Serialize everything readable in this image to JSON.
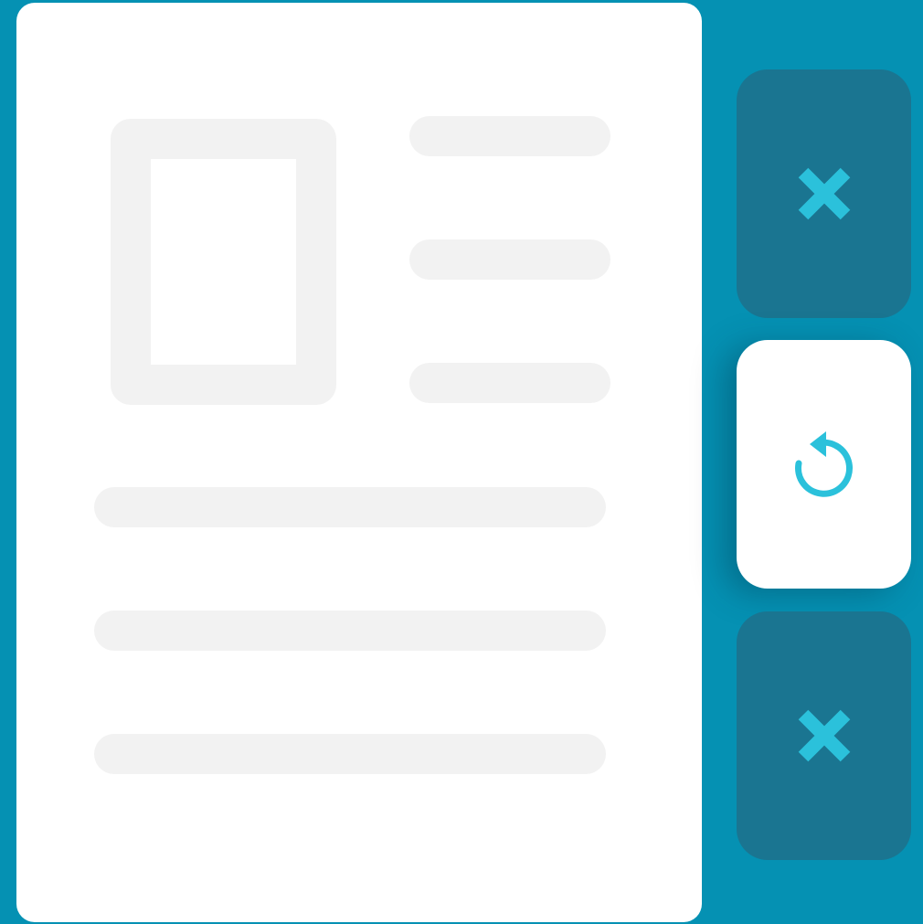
{
  "colors": {
    "background": "#0591B3",
    "card": "#FFFFFF",
    "placeholder": "#F2F2F2",
    "button_dark": "#1A7591",
    "button_light": "#FFFFFF",
    "accent": "#2BC1DB"
  },
  "document": {
    "image_placeholder": "image-icon",
    "side_line_count": 3,
    "body_line_count": 3
  },
  "actions": [
    {
      "icon": "close-icon",
      "state": "default"
    },
    {
      "icon": "refresh-icon",
      "state": "selected"
    },
    {
      "icon": "close-icon",
      "state": "default"
    }
  ]
}
